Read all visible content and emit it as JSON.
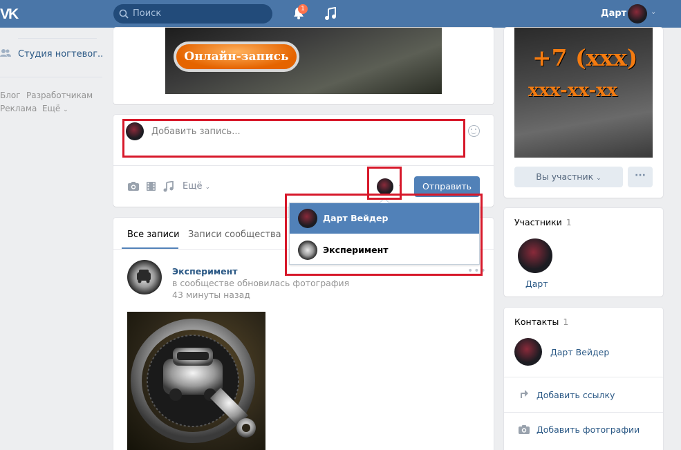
{
  "header": {
    "logo": "VK",
    "search_placeholder": "Поиск",
    "notifications_count": "1",
    "user_name": "Дарт"
  },
  "left_menu": {
    "group_item": "Студия ногтевог..",
    "footer": [
      "Блог",
      "Разработчикам",
      "Реклама",
      "Ещё"
    ]
  },
  "banner": {
    "button_text": "Онлайн-запись"
  },
  "composer": {
    "placeholder": "Добавить запись...",
    "more_label": "Ещё",
    "send_label": "Отправить"
  },
  "author_dropdown": {
    "options": [
      "Дарт Вейдер",
      "Эксперимент"
    ],
    "selected": "Дарт Вейдер"
  },
  "feed": {
    "tabs": [
      "Все записи",
      "Записи сообщества"
    ],
    "active_tab": "Все записи",
    "post": {
      "author": "Эксперимент",
      "subtitle": "в сообществе обновилась фотография",
      "time": "43 минуты назад"
    }
  },
  "right_column": {
    "cover_line1": "+7 (xxx)",
    "cover_line2": "xxx-xx-xx",
    "member_button": "Вы участник",
    "members_title": "Участники",
    "members_count": "1",
    "member_name": "Дарт",
    "contacts_title": "Контакты",
    "contacts_count": "1",
    "contact_name": "Дарт Вейдер",
    "add_link": "Добавить ссылку",
    "add_photos": "Добавить фотографии"
  },
  "colors": {
    "header_blue": "#4a76a8",
    "accent_button": "#5181b8",
    "link": "#2a5885",
    "highlight_red": "#d7182a"
  }
}
